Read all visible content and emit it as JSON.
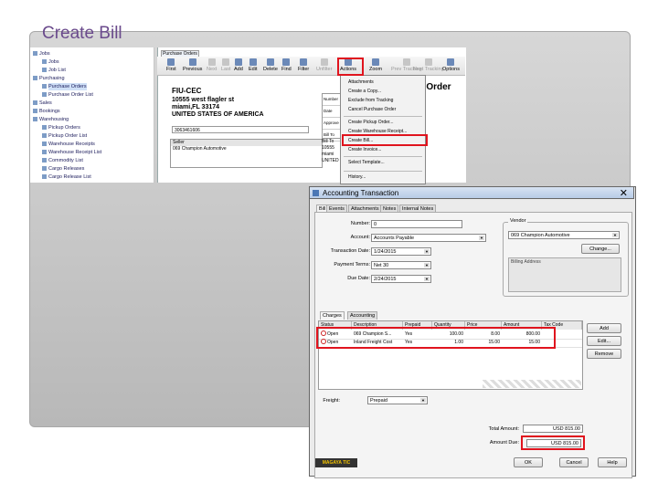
{
  "slide": {
    "title": "Create Bill"
  },
  "tree": {
    "items": [
      {
        "label": "Jobs",
        "indent": 0
      },
      {
        "label": "Jobs",
        "indent": 1
      },
      {
        "label": "Job List",
        "indent": 1
      },
      {
        "label": "Purchasing",
        "indent": 0
      },
      {
        "label": "Purchase Orders",
        "indent": 1,
        "selected": true
      },
      {
        "label": "Purchase Order List",
        "indent": 1
      },
      {
        "label": "Sales",
        "indent": 0
      },
      {
        "label": "Bookings",
        "indent": 0
      },
      {
        "label": "Warehousing",
        "indent": 0
      },
      {
        "label": "Pickup Orders",
        "indent": 1
      },
      {
        "label": "Pickup Order List",
        "indent": 1
      },
      {
        "label": "Warehouse Receipts",
        "indent": 1
      },
      {
        "label": "Warehouse Receipt List",
        "indent": 1
      },
      {
        "label": "Commodity List",
        "indent": 1
      },
      {
        "label": "Cargo Releases",
        "indent": 1
      },
      {
        "label": "Cargo Release List",
        "indent": 1
      }
    ]
  },
  "po_window": {
    "tab_label": "Purchase Orders",
    "toolbar": [
      {
        "label": "First",
        "dim": false
      },
      {
        "label": "Previous",
        "dim": false
      },
      {
        "label": "Next",
        "dim": true
      },
      {
        "label": "Last",
        "dim": true
      },
      {
        "label": "Add",
        "dim": false
      },
      {
        "label": "Edit",
        "dim": false
      },
      {
        "label": "Delete",
        "dim": false
      },
      {
        "label": "Find",
        "dim": false
      },
      {
        "label": "Filter",
        "dim": false
      },
      {
        "label": "Unfilter",
        "dim": true
      },
      {
        "label": "Actions",
        "dim": false
      },
      {
        "label": "Zoom",
        "dim": false
      },
      {
        "label": "Prev Tracking",
        "dim": true
      },
      {
        "label": "Next Tracking",
        "dim": true
      },
      {
        "label": "Options",
        "dim": false
      }
    ],
    "company": "FIU-CEC",
    "address1": "10555 west flagler st",
    "address2": "miami,FL 33174",
    "address3": "UNITED STATES OF AMERICA",
    "po_number": "3063461606",
    "seller_label": "Seller",
    "seller_value": "069 Champion Automotive",
    "doc_title": "e Order",
    "side_labels": [
      "Number",
      "Date",
      "Approve",
      "Bill To"
    ],
    "bill_to_lines": [
      "Bill To",
      "10555",
      "miami",
      "UNITED"
    ]
  },
  "actions_menu": {
    "items": [
      "Attachments",
      "Create a Copy...",
      "Exclude from Tracking",
      "Cancel Purchase Order",
      "Create Pickup Order...",
      "Create Warehouse Receipt...",
      "Create Bill...",
      "Create Invoice...",
      "Select Template...",
      "History..."
    ]
  },
  "dialog": {
    "title": "Accounting Transaction",
    "close_glyph": "✕",
    "tabs": [
      "Bill",
      "Events",
      "Attachments",
      "Notes",
      "Internal Notes"
    ],
    "fields": {
      "number_label": "Number:",
      "number_value": "0",
      "account_label": "Account:",
      "account_value": "Accounts Payable",
      "txn_date_label": "Transaction Date:",
      "txn_date_value": "1/24/2015",
      "terms_label": "Payment Terms:",
      "terms_value": "Net 30",
      "due_label": "Due Date:",
      "due_value": "2/24/2015"
    },
    "vendor": {
      "group_label": "Vendor",
      "value": "069 Champion Automotive",
      "billing_label": "Billing Address",
      "change_label": "Change..."
    },
    "subtabs": [
      "Charges",
      "Accounting"
    ],
    "grid": {
      "headers": [
        "Status",
        "Description",
        "Prepaid",
        "Quantity",
        "Price",
        "Amount",
        "Tax Code"
      ],
      "rows": [
        {
          "status": "Open",
          "description": "069 Champion S...",
          "prepaid": "Yes",
          "quantity": "100.00",
          "price": "8.00",
          "amount": "800.00",
          "tax": ""
        },
        {
          "status": "Open",
          "description": "Inland Freight Cost",
          "prepaid": "Yes",
          "quantity": "1.00",
          "price": "15.00",
          "amount": "15.00",
          "tax": ""
        }
      ]
    },
    "side_buttons": [
      "Add",
      "Edit...",
      "Remove"
    ],
    "freight_label": "Freight:",
    "freight_value": "Prepaid",
    "total_label": "Total Amount:",
    "total_value": "USD 815.00",
    "due_amount_label": "Amount Due:",
    "due_amount_value": "USD 815.00",
    "logo_text": "MAGAYA TIC",
    "buttons": [
      "OK",
      "Cancel",
      "Help"
    ]
  },
  "colors": {
    "highlight": "#e0141e",
    "title": "#6a4a8c"
  }
}
